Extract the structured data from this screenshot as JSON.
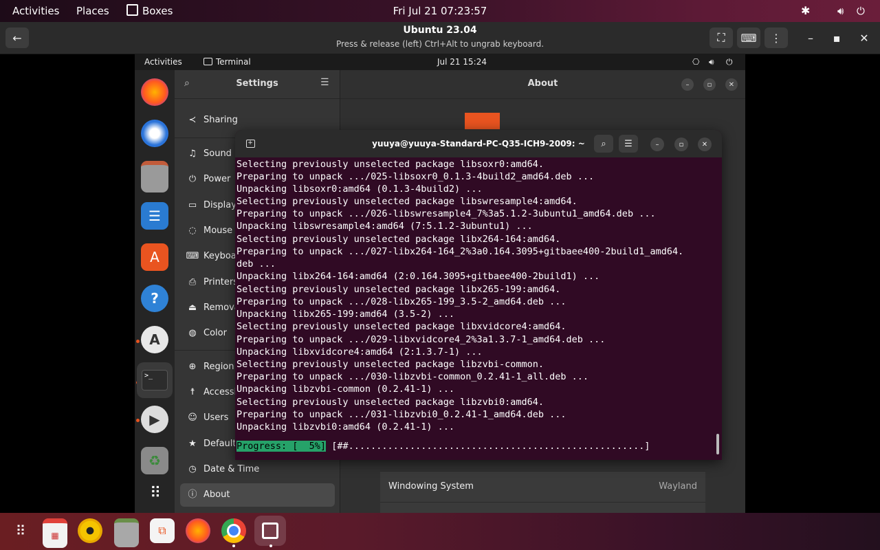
{
  "host_topbar": {
    "activities": "Activities",
    "places": "Places",
    "app_name": "Boxes",
    "clock": "Fri Jul 21  07:23:57"
  },
  "boxes_header": {
    "title": "Ubuntu 23.04",
    "subtitle": "Press & release (left) Ctrl+Alt to ungrab keyboard."
  },
  "guest_topbar": {
    "activities": "Activities",
    "app_name": "Terminal",
    "clock": "Jul 21  15:24"
  },
  "settings": {
    "title": "Settings",
    "panel_title": "About",
    "sidebar_items": [
      {
        "label": "Sharing",
        "icon": "share-icon"
      },
      {
        "label": "Sound",
        "icon": "music-note-icon"
      },
      {
        "label": "Power",
        "icon": "power-icon"
      },
      {
        "label": "Displays",
        "icon": "monitor-icon"
      },
      {
        "label": "Mouse &",
        "icon": "mouse-icon"
      },
      {
        "label": "Keyboa",
        "icon": "keyboard-icon"
      },
      {
        "label": "Printers",
        "icon": "printer-icon"
      },
      {
        "label": "Remova",
        "icon": "usb-icon"
      },
      {
        "label": "Color",
        "icon": "color-icon"
      },
      {
        "label": "Region",
        "icon": "globe-icon"
      },
      {
        "label": "Accessil",
        "icon": "accessibility-icon"
      },
      {
        "label": "Users",
        "icon": "user-icon"
      },
      {
        "label": "Default",
        "icon": "star-icon"
      },
      {
        "label": "Date & Time",
        "icon": "clock-icon"
      },
      {
        "label": "About",
        "icon": "info-icon"
      }
    ],
    "windowing_system_label": "Windowing System",
    "windowing_system_value": "Wayland"
  },
  "terminal": {
    "title": "yuuya@yuuya-Standard-PC-Q35-ICH9-2009: ~",
    "lines": [
      "Selecting previously unselected package libsoxr0:amd64.",
      "Preparing to unpack .../025-libsoxr0_0.1.3-4build2_amd64.deb ...",
      "Unpacking libsoxr0:amd64 (0.1.3-4build2) ...",
      "Selecting previously unselected package libswresample4:amd64.",
      "Preparing to unpack .../026-libswresample4_7%3a5.1.2-3ubuntu1_amd64.deb ...",
      "Unpacking libswresample4:amd64 (7:5.1.2-3ubuntu1) ...",
      "Selecting previously unselected package libx264-164:amd64.",
      "Preparing to unpack .../027-libx264-164_2%3a0.164.3095+gitbaee400-2build1_amd64.",
      "deb ...",
      "Unpacking libx264-164:amd64 (2:0.164.3095+gitbaee400-2build1) ...",
      "Selecting previously unselected package libx265-199:amd64.",
      "Preparing to unpack .../028-libx265-199_3.5-2_amd64.deb ...",
      "Unpacking libx265-199:amd64 (3.5-2) ...",
      "Selecting previously unselected package libxvidcore4:amd64.",
      "Preparing to unpack .../029-libxvidcore4_2%3a1.3.7-1_amd64.deb ...",
      "Unpacking libxvidcore4:amd64 (2:1.3.7-1) ...",
      "Selecting previously unselected package libzvbi-common.",
      "Preparing to unpack .../030-libzvbi-common_0.2.41-1_all.deb ...",
      "Unpacking libzvbi-common (0.2.41-1) ...",
      "Selecting previously unselected package libzvbi0:amd64.",
      "Preparing to unpack .../031-libzvbi0_0.2.41-1_amd64.deb ...",
      "Unpacking libzvbi0:amd64 (0.2.41-1) ..."
    ],
    "progress_label": "Progress: [  5%]",
    "progress_bar": "[##.....................................................]",
    "progress_percent": 5
  },
  "colors": {
    "ubuntu_orange": "#e95420",
    "terminal_bg": "#300a24",
    "progress_green": "#26a269"
  },
  "guest_dock_icons": [
    "firefox-icon",
    "thunderbird-icon",
    "files-icon",
    "libreoffice-writer-icon",
    "app-center-icon",
    "help-icon",
    "software-updater-icon",
    "terminal-icon",
    "rhythmbox-icon",
    "trash-icon",
    "show-apps-icon"
  ],
  "host_dash_icons": [
    "show-apps-icon",
    "calendar-icon",
    "rhythmbox-icon",
    "files-icon",
    "software-icon",
    "firefox-icon",
    "chrome-icon",
    "boxes-icon"
  ]
}
